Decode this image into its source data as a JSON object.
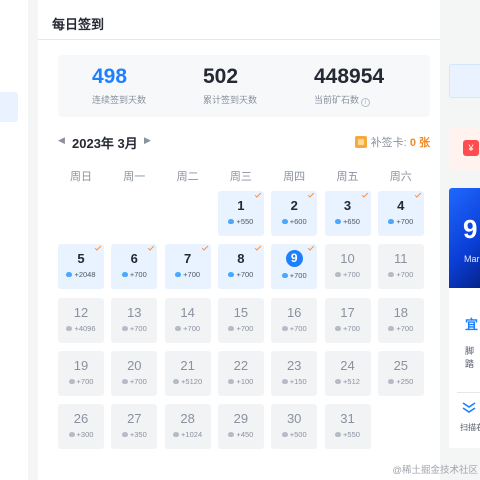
{
  "header": {
    "title": "每日签到"
  },
  "stats": [
    {
      "value": "498",
      "label": "连续签到天数"
    },
    {
      "value": "502",
      "label": "累计签到天数"
    },
    {
      "value": "448954",
      "label": "当前矿石数"
    }
  ],
  "calendar": {
    "month_label": "2023年 3月",
    "prev_icon": "chevron-left-icon",
    "next_icon": "chevron-right-icon",
    "makeup_card_label": "补签卡:",
    "makeup_card_count": "0 张",
    "weekdays": [
      "周日",
      "周一",
      "周二",
      "周三",
      "周四",
      "周五",
      "周六"
    ],
    "days": [
      {
        "day": "1",
        "reward": "+550",
        "state": "signed"
      },
      {
        "day": "2",
        "reward": "+600",
        "state": "signed"
      },
      {
        "day": "3",
        "reward": "+650",
        "state": "signed"
      },
      {
        "day": "4",
        "reward": "+700",
        "state": "signed"
      },
      {
        "day": "5",
        "reward": "+2048",
        "state": "signed"
      },
      {
        "day": "6",
        "reward": "+700",
        "state": "signed"
      },
      {
        "day": "7",
        "reward": "+700",
        "state": "signed"
      },
      {
        "day": "8",
        "reward": "+700",
        "state": "signed"
      },
      {
        "day": "9",
        "reward": "+700",
        "state": "today"
      },
      {
        "day": "10",
        "reward": "+700",
        "state": "future"
      },
      {
        "day": "11",
        "reward": "+700",
        "state": "future"
      },
      {
        "day": "12",
        "reward": "+4096",
        "state": "future"
      },
      {
        "day": "13",
        "reward": "+700",
        "state": "future"
      },
      {
        "day": "14",
        "reward": "+700",
        "state": "future"
      },
      {
        "day": "15",
        "reward": "+700",
        "state": "future"
      },
      {
        "day": "16",
        "reward": "+700",
        "state": "future"
      },
      {
        "day": "17",
        "reward": "+700",
        "state": "future"
      },
      {
        "day": "18",
        "reward": "+700",
        "state": "future"
      },
      {
        "day": "19",
        "reward": "+700",
        "state": "future"
      },
      {
        "day": "20",
        "reward": "+700",
        "state": "future"
      },
      {
        "day": "21",
        "reward": "+5120",
        "state": "future"
      },
      {
        "day": "22",
        "reward": "+100",
        "state": "future"
      },
      {
        "day": "23",
        "reward": "+150",
        "state": "future"
      },
      {
        "day": "24",
        "reward": "+512",
        "state": "future"
      },
      {
        "day": "25",
        "reward": "+250",
        "state": "future"
      },
      {
        "day": "26",
        "reward": "+300",
        "state": "future"
      },
      {
        "day": "27",
        "reward": "+350",
        "state": "future"
      },
      {
        "day": "28",
        "reward": "+1024",
        "state": "future"
      },
      {
        "day": "29",
        "reward": "+450",
        "state": "future"
      },
      {
        "day": "30",
        "reward": "+500",
        "state": "future"
      },
      {
        "day": "31",
        "reward": "+550",
        "state": "future"
      }
    ]
  },
  "right_panel": {
    "red_envelope_glyph": "¥",
    "banner_number": "9",
    "banner_sub": "Mar",
    "promo_title": "宜",
    "promo_sub": "脚踏",
    "scan_label": "扫描右"
  },
  "watermark": "@稀土掘金技术社区",
  "colors": {
    "accent": "#1e80ff",
    "signed_bg": "#e8f3ff",
    "future_bg": "#f2f3f5",
    "check": "#ff8d3a"
  }
}
